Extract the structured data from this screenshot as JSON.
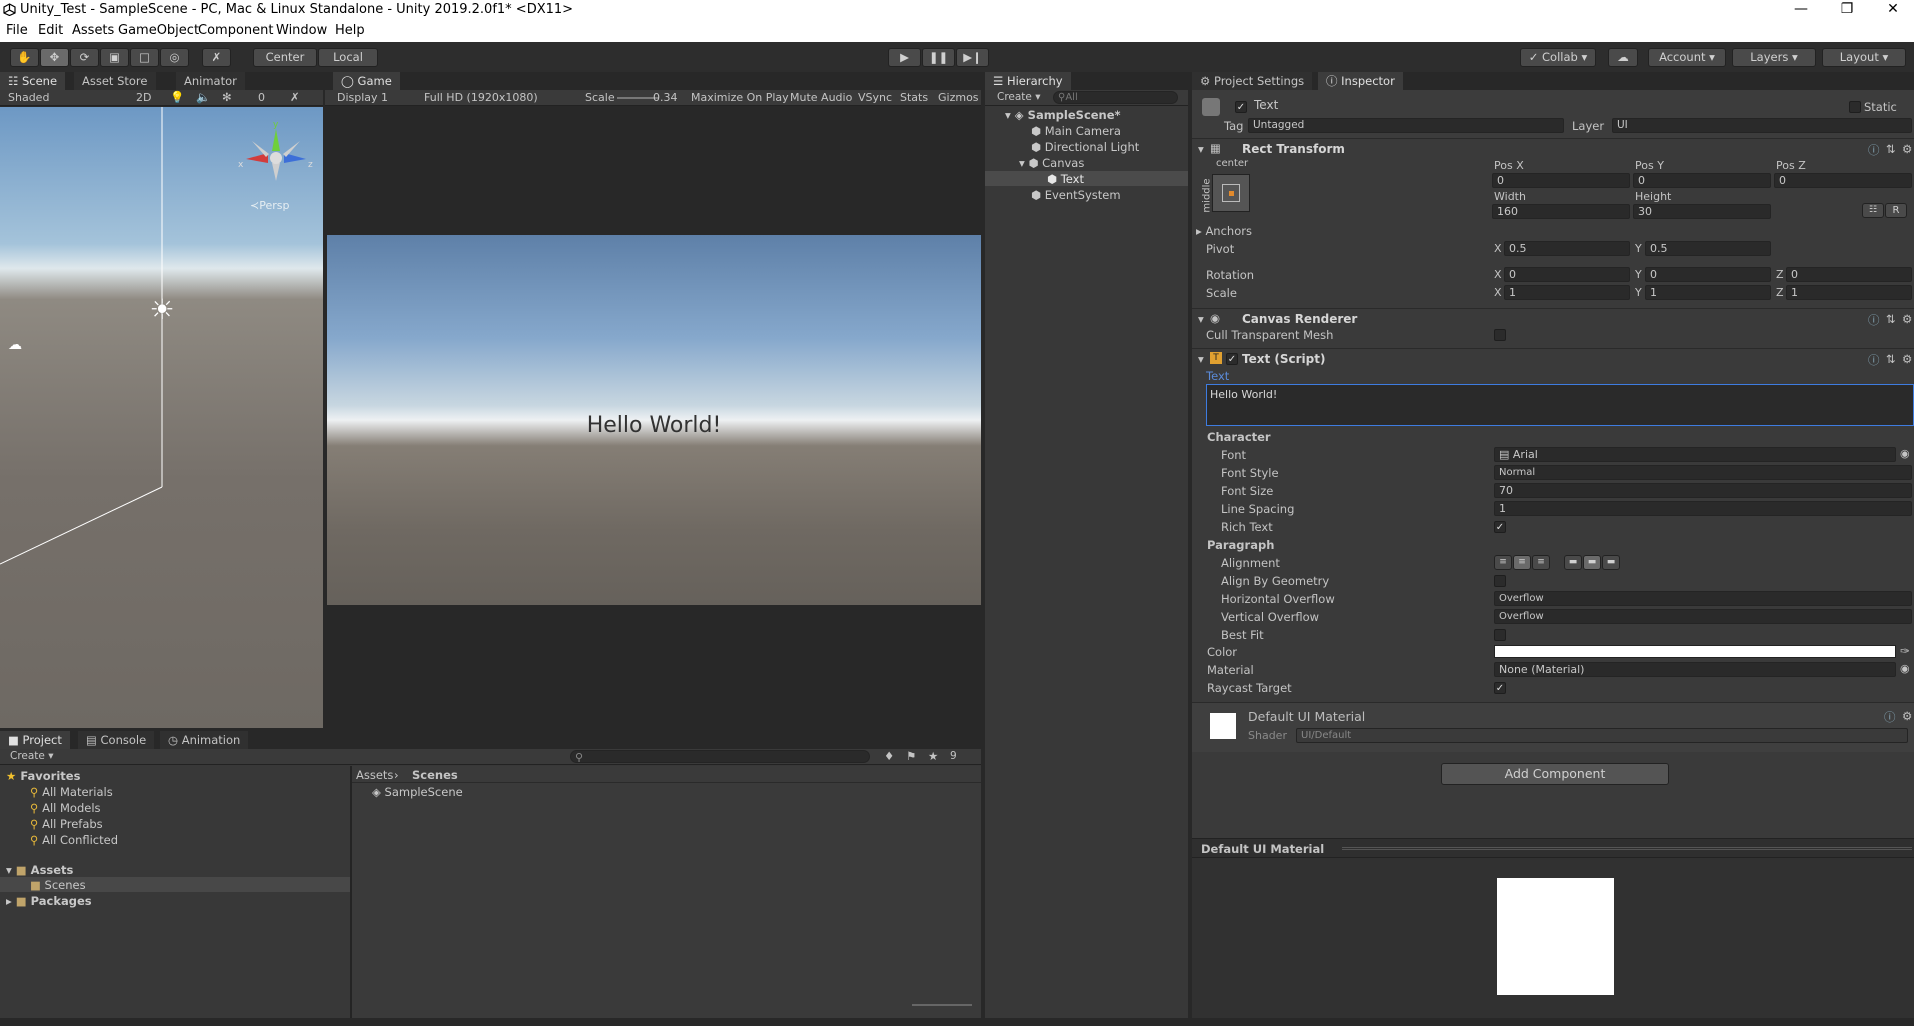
{
  "window": {
    "title": "Unity_Test - SampleScene - PC, Mac & Linux Standalone - Unity 2019.2.0f1* <DX11>"
  },
  "menu": [
    "File",
    "Edit",
    "Assets",
    "GameObject",
    "Component",
    "Window",
    "Help"
  ],
  "toolbar": {
    "pivot": "Center",
    "space": "Local",
    "collab": "Collab",
    "account": "Account",
    "layers": "Layers",
    "layout": "Layout"
  },
  "scene_view": {
    "tabs": [
      "Scene",
      "Asset Store",
      "Animator"
    ],
    "shading": "Shaded",
    "mode2d": "2D",
    "gizmo_count": "0",
    "persp": "Persp",
    "axis_x": "x",
    "axis_y": "y",
    "axis_z": "z"
  },
  "game_view": {
    "tab": "Game",
    "display": "Display 1",
    "resolution": "Full HD (1920x1080)",
    "scale_label": "Scale",
    "scale_value": "0.34",
    "options": [
      "Maximize On Play",
      "Mute Audio",
      "VSync",
      "Stats",
      "Gizmos"
    ],
    "hello_text": "Hello World!"
  },
  "hierarchy": {
    "tab": "Hierarchy",
    "create": "Create",
    "search_placeholder": "All",
    "scene": "SampleScene*",
    "items": [
      "Main Camera",
      "Directional Light",
      "Canvas",
      "Text",
      "EventSystem"
    ]
  },
  "inspector": {
    "tabs": [
      "Project Settings",
      "Inspector"
    ],
    "object_name": "Text",
    "static_label": "Static",
    "tag_label": "Tag",
    "tag_value": "Untagged",
    "layer_label": "Layer",
    "layer_value": "UI",
    "rect_transform": {
      "title": "Rect Transform",
      "anchor_h": "center",
      "anchor_v": "middle",
      "pos_x_label": "Pos X",
      "pos_x": "0",
      "pos_y_label": "Pos Y",
      "pos_y": "0",
      "pos_z_label": "Pos Z",
      "pos_z": "0",
      "width_label": "Width",
      "width": "160",
      "height_label": "Height",
      "height": "30",
      "anchors_label": "Anchors",
      "pivot_label": "Pivot",
      "pivot_x": "0.5",
      "pivot_y": "0.5",
      "rotation_label": "Rotation",
      "rot_x": "0",
      "rot_y": "0",
      "rot_z": "0",
      "scale_label": "Scale",
      "scale_x": "1",
      "scale_y": "1",
      "scale_z": "1",
      "x": "X",
      "y": "Y",
      "z": "Z",
      "r_btn": "R"
    },
    "canvas_renderer": {
      "title": "Canvas Renderer",
      "cull_label": "Cull Transparent Mesh"
    },
    "text_script": {
      "title": "Text (Script)",
      "text_label": "Text",
      "text_value": "Hello World!",
      "character": "Character",
      "font_label": "Font",
      "font_value": "Arial",
      "font_style_label": "Font Style",
      "font_style_value": "Normal",
      "font_size_label": "Font Size",
      "font_size_value": "70",
      "line_spacing_label": "Line Spacing",
      "line_spacing_value": "1",
      "rich_text_label": "Rich Text",
      "paragraph": "Paragraph",
      "alignment_label": "Alignment",
      "align_geom_label": "Align By Geometry",
      "h_overflow_label": "Horizontal Overflow",
      "h_overflow_value": "Overflow",
      "v_overflow_label": "Vertical Overflow",
      "v_overflow_value": "Overflow",
      "best_fit_label": "Best Fit",
      "color_label": "Color",
      "material_label": "Material",
      "material_value": "None (Material)",
      "raycast_label": "Raycast Target"
    },
    "material": {
      "name": "Default UI Material",
      "shader_label": "Shader",
      "shader_value": "UI/Default"
    },
    "add_component": "Add Component",
    "preview_title": "Default UI Material"
  },
  "project": {
    "tabs": [
      "Project",
      "Console",
      "Animation"
    ],
    "create": "Create",
    "hidden_count": "9",
    "favorites": "Favorites",
    "fav_items": [
      "All Materials",
      "All Models",
      "All Prefabs",
      "All Conflicted"
    ],
    "assets": "Assets",
    "scenes": "Scenes",
    "packages": "Packages",
    "breadcrumb_root": "Assets",
    "breadcrumb_leaf": "Scenes",
    "files": [
      "SampleScene"
    ]
  },
  "colors": {
    "accent": "#3e7ce0",
    "panel": "#383838",
    "header": "#282828"
  }
}
